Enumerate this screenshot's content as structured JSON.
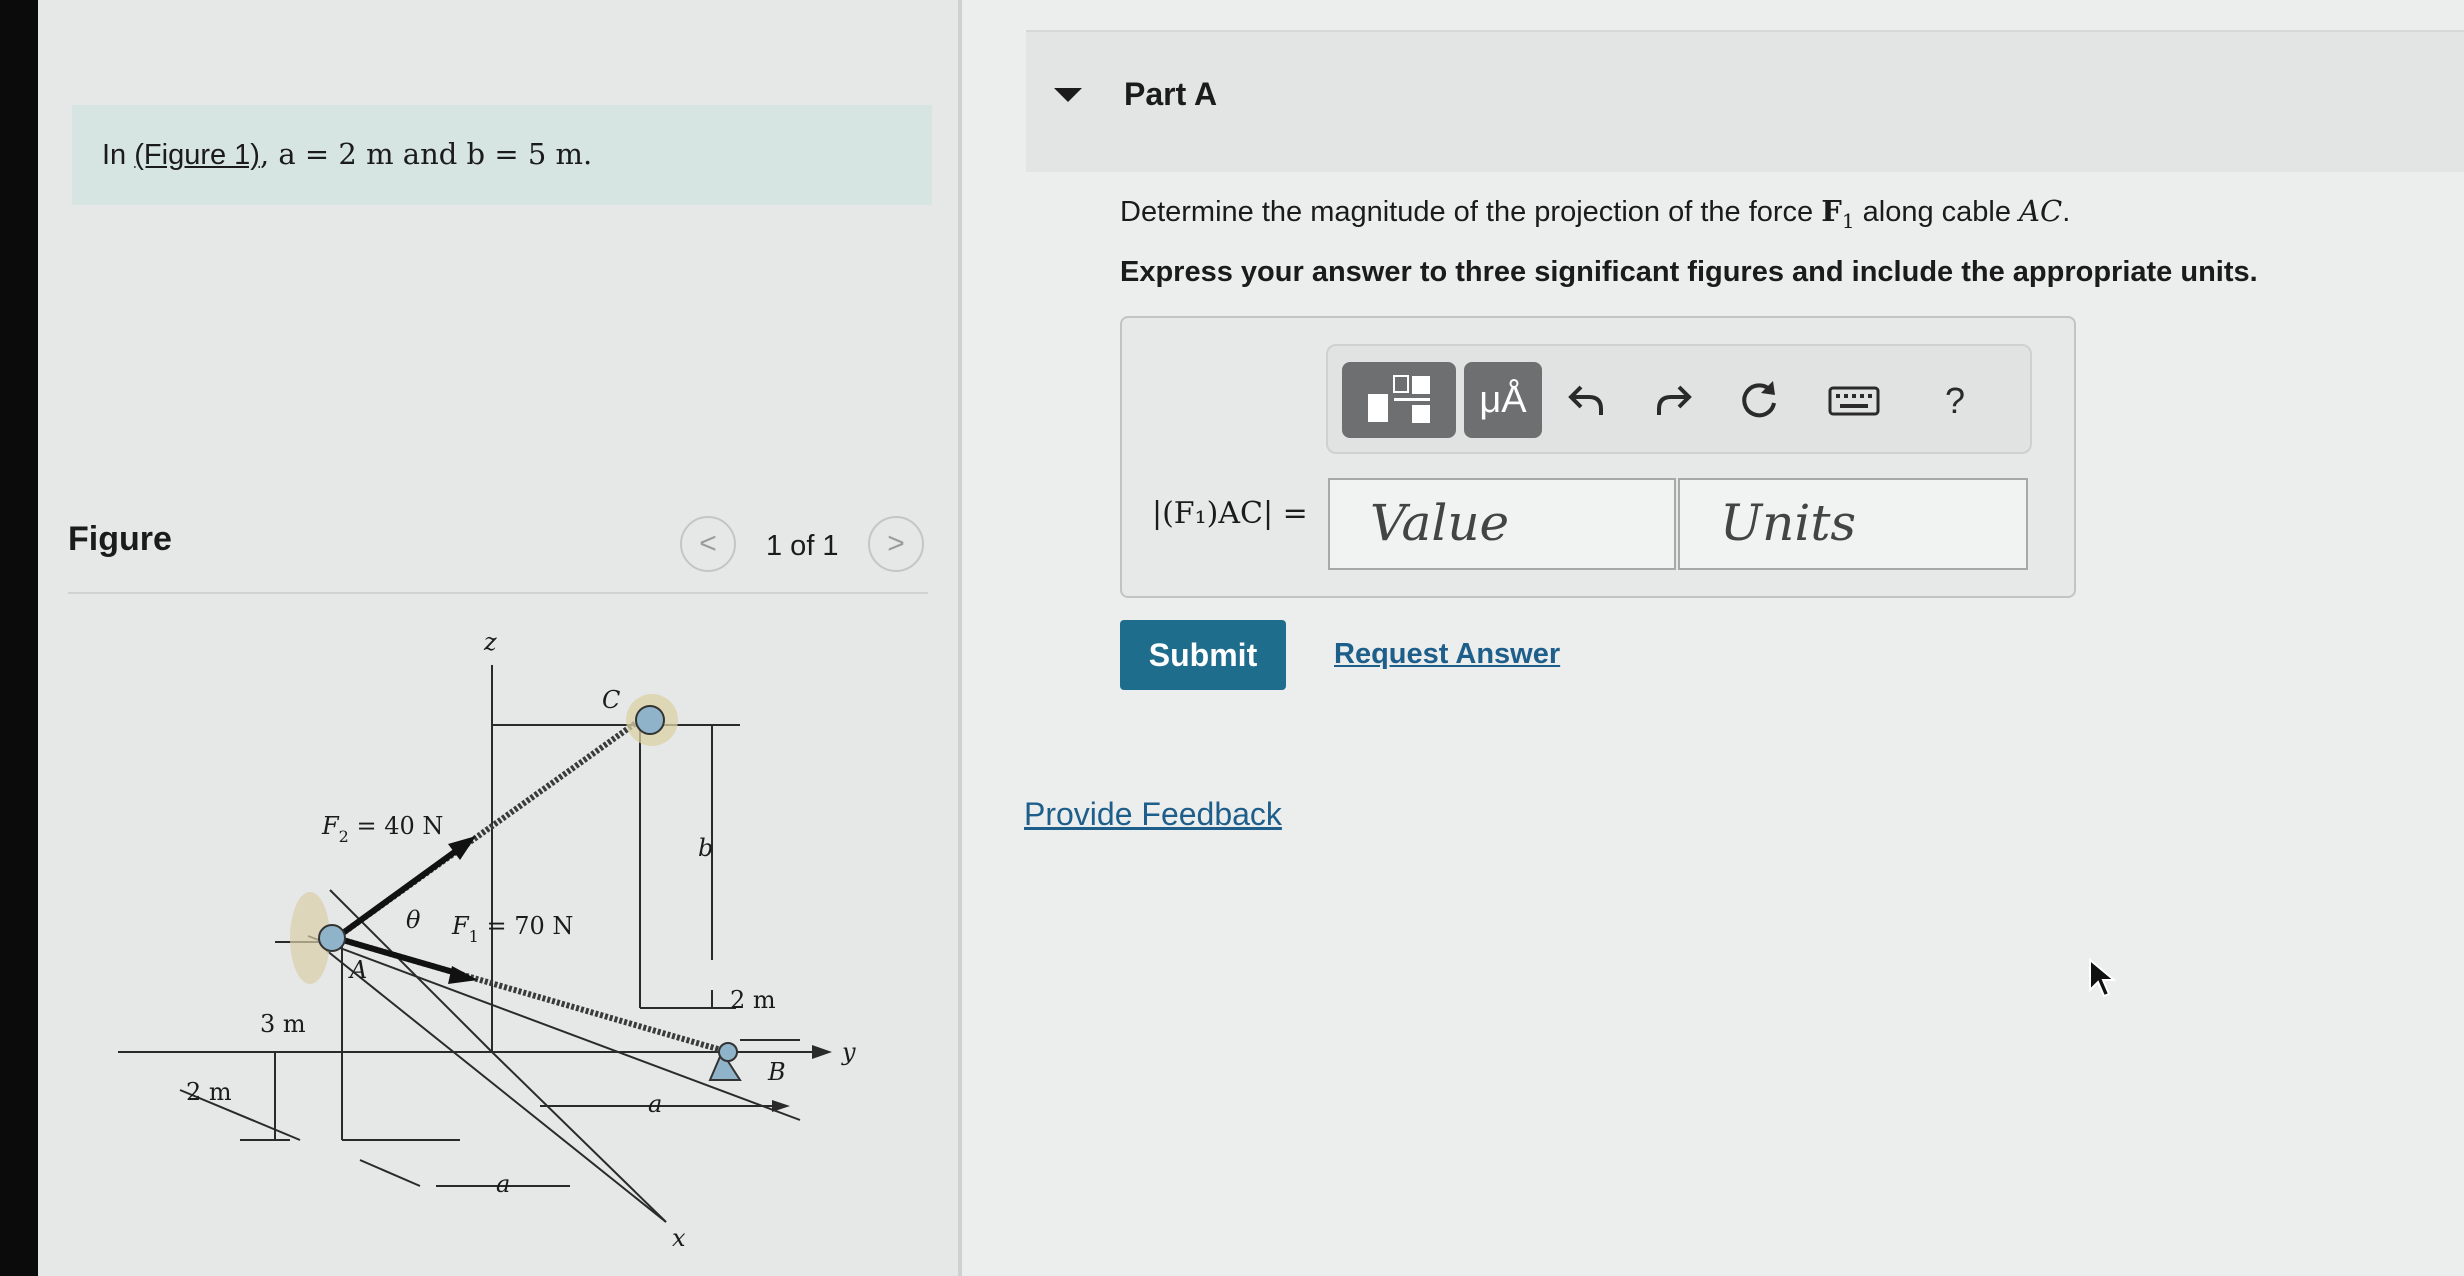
{
  "problem": {
    "prefix": "In ",
    "figure_link": "(Figure 1)",
    "conditions": ", a = 2 m and b = 5 m."
  },
  "figure_panel": {
    "title": "Figure",
    "counter": "1 of 1",
    "prev_glyph": "<",
    "next_glyph": ">",
    "labels": {
      "z": "z",
      "y": "y",
      "x": "x",
      "C": "C",
      "A": "A",
      "B": "B",
      "theta": "θ",
      "b": "b",
      "a1": "a",
      "a2": "a",
      "three_m": "3 m",
      "two_m_left": "2 m",
      "two_m_right": "2 m",
      "F2": "F",
      "F2_sub": "2",
      "F2_val": " = 40 N",
      "F1": "F",
      "F1_sub": "1",
      "F1_val": " = 70 N"
    }
  },
  "part_a": {
    "title": "Part A",
    "question_pre": "Determine the magnitude of the projection of the force ",
    "question_force": "F",
    "question_force_sub": "1",
    "question_mid": " along cable ",
    "question_cable": "AC",
    "question_end": ".",
    "instruction": "Express your answer to three significant figures and include the appropriate units.",
    "answer_label": "|(F₁)AC| =",
    "value_placeholder": "Value",
    "units_placeholder": "Units",
    "toolbar": {
      "units_button": "μÅ",
      "help": "?"
    },
    "submit": "Submit",
    "request_answer": "Request Answer"
  },
  "feedback": "Provide Feedback"
}
